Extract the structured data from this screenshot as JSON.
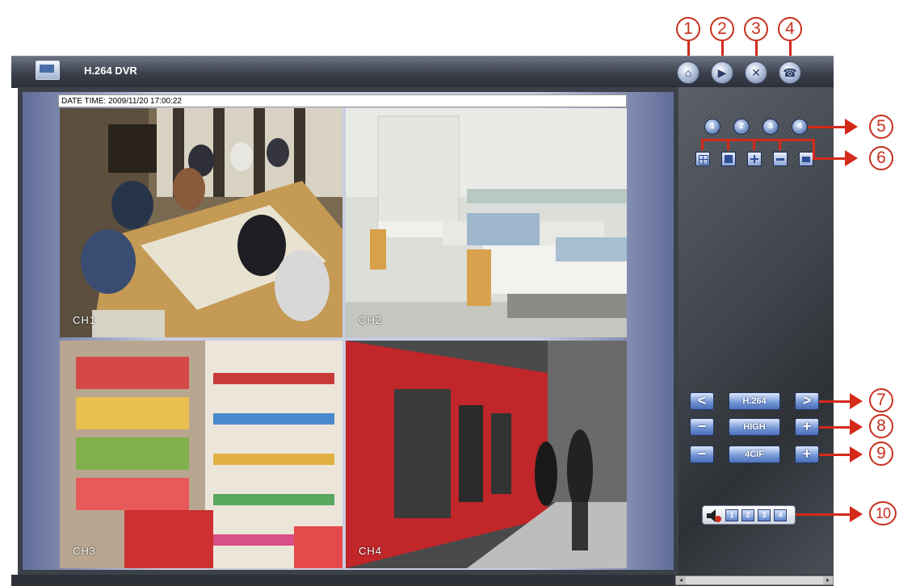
{
  "app": {
    "title": "H.264 DVR"
  },
  "toolbar": {
    "buttons": [
      {
        "icon": "home-icon",
        "glyph": "⌂"
      },
      {
        "icon": "playback-icon",
        "glyph": "▶"
      },
      {
        "icon": "tools-icon",
        "glyph": "✕"
      },
      {
        "icon": "network-icon",
        "glyph": "☎"
      }
    ]
  },
  "viewer": {
    "datetime": "DATE TIME: 2009/11/20 17:00:22",
    "channels": [
      {
        "label": "CH1",
        "scene": "meeting room"
      },
      {
        "label": "CH2",
        "scene": "hospital ward"
      },
      {
        "label": "CH3",
        "scene": "store shelves"
      },
      {
        "label": "CH4",
        "scene": "train platform"
      }
    ]
  },
  "channel_buttons": [
    "1",
    "2",
    "3",
    "4"
  ],
  "layout_buttons": [
    "quad-view-icon",
    "pip-view-icon",
    "split-view-icon",
    "single-view-icon",
    "snapshot-icon"
  ],
  "controls": {
    "codec": {
      "prev": "<",
      "value": "H.264",
      "next": ">"
    },
    "quality": {
      "minus": "−",
      "value": "HIGH",
      "plus": "+"
    },
    "resolution": {
      "minus": "−",
      "value": "4CIF",
      "plus": "+"
    }
  },
  "audio": {
    "channels": [
      "1",
      "2",
      "3",
      "4"
    ]
  },
  "callouts": [
    "1",
    "2",
    "3",
    "4",
    "5",
    "6",
    "7",
    "8",
    "9",
    "10"
  ],
  "colors": {
    "callout": "#c8301e",
    "button_blue": "#6b8fd0",
    "panel": "#3e434a"
  }
}
